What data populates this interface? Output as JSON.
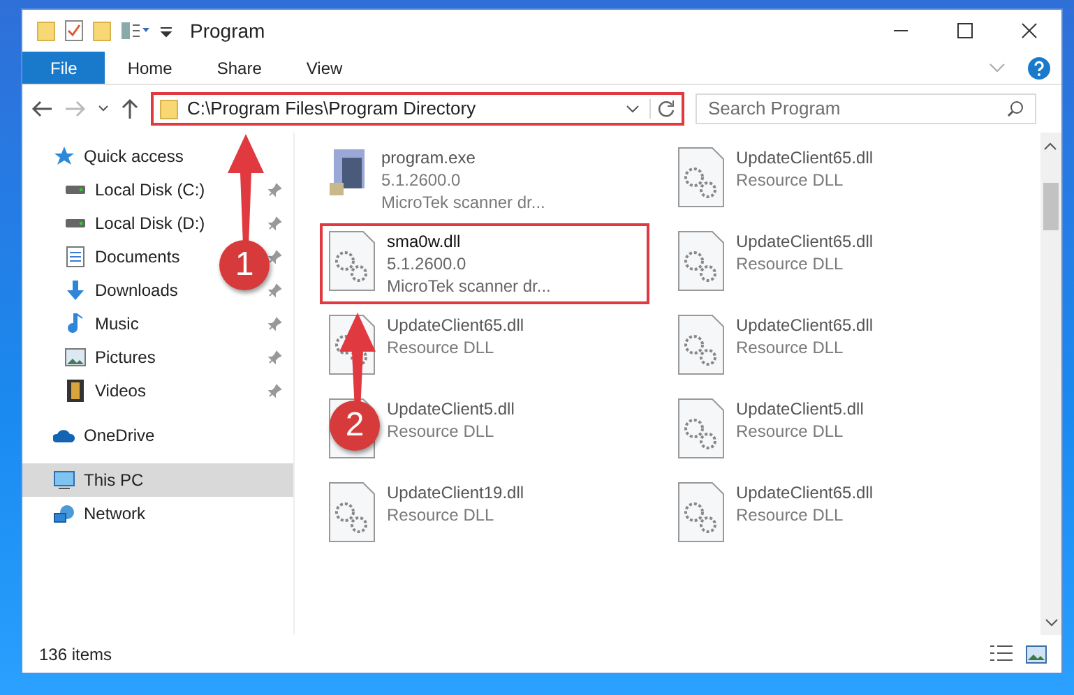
{
  "window": {
    "title": "Program"
  },
  "ribbon_tabs": [
    {
      "label": "File",
      "selected": true
    },
    {
      "label": "Home",
      "selected": false
    },
    {
      "label": "Share",
      "selected": false
    },
    {
      "label": "View",
      "selected": false
    }
  ],
  "address": {
    "value": "C:\\Program Files\\Program Directory",
    "highlighted": true
  },
  "search": {
    "placeholder": "Search Program"
  },
  "sidebar": {
    "items": [
      {
        "label": "Quick access",
        "kind": "star",
        "pinned": false,
        "selected": false,
        "children": [
          {
            "label": "Local Disk (C:)",
            "kind": "disk",
            "pinned": true,
            "selected": false
          },
          {
            "label": "Local Disk (D:)",
            "kind": "disk",
            "pinned": true,
            "selected": false
          },
          {
            "label": "Documents",
            "kind": "document",
            "pinned": true,
            "selected": false
          },
          {
            "label": "Downloads",
            "kind": "download",
            "pinned": true,
            "selected": false
          },
          {
            "label": "Music",
            "kind": "music",
            "pinned": true,
            "selected": false
          },
          {
            "label": "Pictures",
            "kind": "pictures",
            "pinned": true,
            "selected": false
          },
          {
            "label": "Videos",
            "kind": "videos",
            "pinned": true,
            "selected": false
          }
        ]
      },
      {
        "label": "OneDrive",
        "kind": "cloud",
        "pinned": false,
        "selected": false
      },
      {
        "label": "This PC",
        "kind": "computer",
        "pinned": false,
        "selected": true
      },
      {
        "label": "Network",
        "kind": "network",
        "pinned": false,
        "selected": false
      }
    ]
  },
  "files": [
    {
      "name": "program.exe",
      "lines": [
        "5.1.2600.0",
        "MicroTek scanner dr..."
      ],
      "kind": "exe",
      "highlighted": false
    },
    {
      "name": "UpdateClient65.dll",
      "lines": [
        "Resource DLL"
      ],
      "kind": "dll",
      "highlighted": false
    },
    {
      "name": "sma0w.dll",
      "lines": [
        "5.1.2600.0",
        "MicroTek scanner dr..."
      ],
      "kind": "dll",
      "highlighted": true
    },
    {
      "name": "UpdateClient65.dll",
      "lines": [
        "Resource DLL"
      ],
      "kind": "dll",
      "highlighted": false
    },
    {
      "name": "UpdateClient65.dll",
      "lines": [
        "Resource DLL"
      ],
      "kind": "dll",
      "highlighted": false
    },
    {
      "name": "UpdateClient65.dll",
      "lines": [
        "Resource DLL"
      ],
      "kind": "dll",
      "highlighted": false
    },
    {
      "name": "UpdateClient5.dll",
      "lines": [
        "Resource DLL"
      ],
      "kind": "dll",
      "highlighted": false
    },
    {
      "name": "UpdateClient5.dll",
      "lines": [
        "Resource DLL"
      ],
      "kind": "dll",
      "highlighted": false
    },
    {
      "name": "UpdateClient19.dll",
      "lines": [
        "Resource DLL"
      ],
      "kind": "dll",
      "highlighted": false
    },
    {
      "name": "UpdateClient65.dll",
      "lines": [
        "Resource DLL"
      ],
      "kind": "dll",
      "highlighted": false
    }
  ],
  "annotations": [
    {
      "label": "1"
    },
    {
      "label": "2"
    }
  ],
  "status_bar": {
    "count": "136 items"
  }
}
